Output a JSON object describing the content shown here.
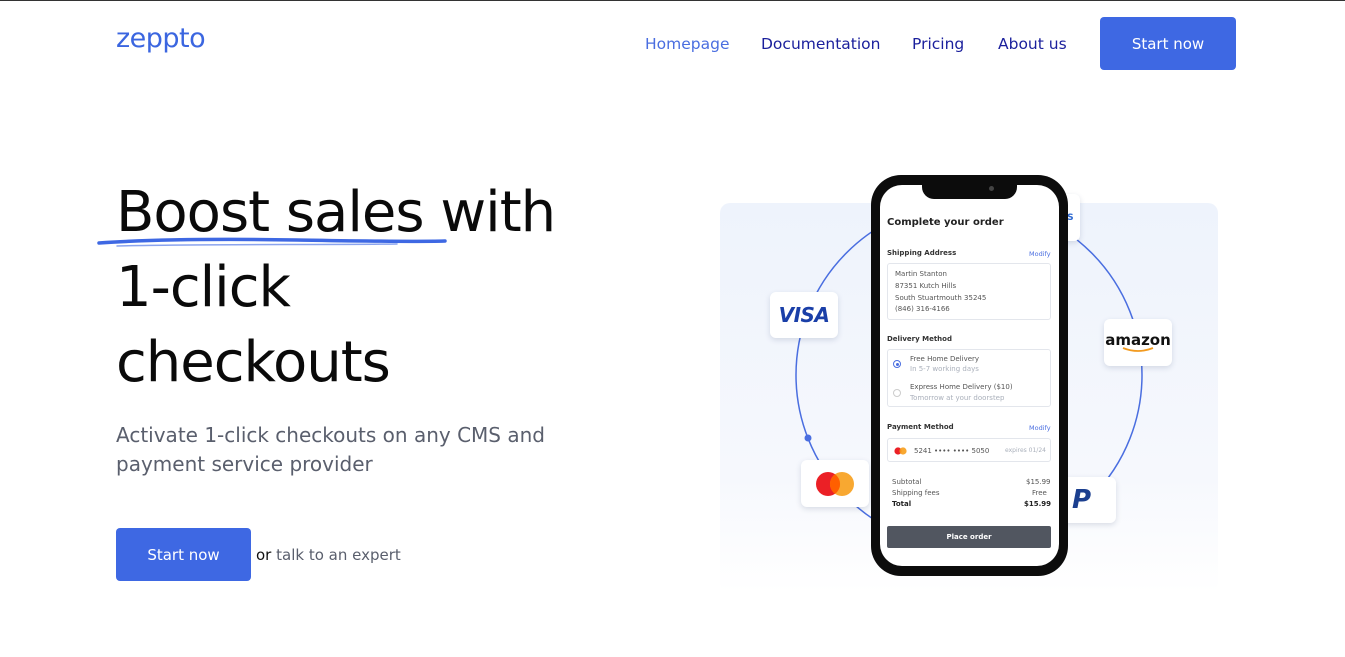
{
  "brand": {
    "logo": "zeppto"
  },
  "nav": {
    "items": [
      {
        "label": "Homepage",
        "active": true
      },
      {
        "label": "Documentation",
        "active": false
      },
      {
        "label": "Pricing",
        "active": false
      },
      {
        "label": "About us",
        "active": false
      }
    ],
    "cta_label": "Start now"
  },
  "hero": {
    "title_line1": "Boost sales with",
    "title_line2": "1-click",
    "title_line3": "checkouts",
    "subtitle": "Activate 1-click checkouts on any CMS and payment service provider",
    "cta_label": "Start now",
    "or_text": "or",
    "expert_link": "talk to an expert"
  },
  "illustration": {
    "payment_cards": {
      "visa": "VISA",
      "amazon": "amazon",
      "paypal": "P",
      "top_partial": "N S"
    },
    "phone": {
      "title": "Complete your order",
      "shipping_label": "Shipping Address",
      "modify_label": "Modify",
      "address": [
        "Martin Stanton",
        "87351 Kutch Hills",
        "South Stuartmouth 35245",
        "(846) 316-4166"
      ],
      "delivery_label": "Delivery Method",
      "delivery_options": [
        {
          "name": "Free Home Delivery",
          "detail": "In 5-7 working days",
          "selected": true
        },
        {
          "name": "Express Home Delivery ($10)",
          "detail": "Tomorrow at your doorstep",
          "selected": false
        }
      ],
      "payment_label": "Payment Method",
      "card_number": "5241 •••• •••• 5050",
      "card_expiry": "expires 01/24",
      "summary": [
        {
          "label": "Subtotal",
          "value": "$15.99"
        },
        {
          "label": "Shipping fees",
          "value": "Free"
        },
        {
          "label": "Total",
          "value": "$15.99"
        }
      ],
      "place_order": "Place order"
    }
  },
  "colors": {
    "accent": "#3e68e3",
    "nav_link": "#1a1f9c",
    "nav_active": "#4a6ee0",
    "ring": "#4a6ee0"
  }
}
